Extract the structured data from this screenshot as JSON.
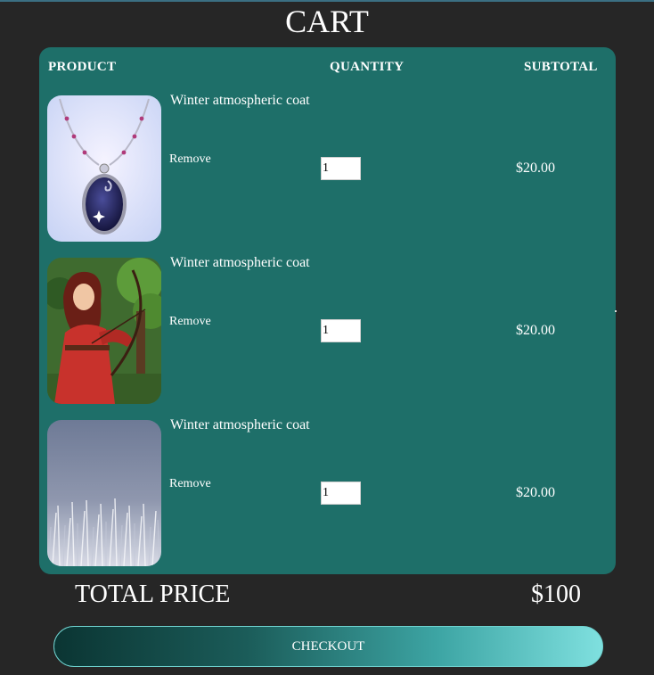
{
  "page": {
    "title": "CART"
  },
  "table": {
    "headers": {
      "product": "PRODUCT",
      "quantity": "QUANTITY",
      "subtotal": "SUBTOTAL"
    },
    "items": [
      {
        "name": "Winter atmospheric coat",
        "remove_label": "Remove",
        "quantity": "1",
        "subtotal": "$20.00",
        "image": "pendant-necklace-image"
      },
      {
        "name": "Winter atmospheric coat",
        "remove_label": "Remove",
        "quantity": "1",
        "subtotal": "$20.00",
        "image": "archer-woman-image"
      },
      {
        "name": "Winter atmospheric coat",
        "remove_label": "Remove",
        "quantity": "1",
        "subtotal": "$20.00",
        "image": "frosty-grass-image"
      }
    ]
  },
  "summary": {
    "total_label": "TOTAL PRICE",
    "total_value": "$100"
  },
  "actions": {
    "checkout_label": "CHECKOUT"
  },
  "colors": {
    "background": "#262626",
    "panel": "#1e6f69",
    "button_start": "#0b3533",
    "button_end": "#7fe0df"
  }
}
